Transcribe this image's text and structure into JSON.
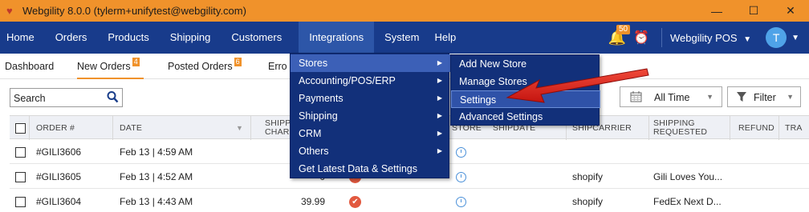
{
  "window": {
    "title": "Webgility 8.0.0 (tylerm+unifytest@webgility.com)",
    "minimize": "—",
    "maximize": "☐",
    "close": "✕"
  },
  "nav": {
    "items": [
      "Home",
      "Orders",
      "Products",
      "Shipping",
      "Customers",
      "Integrations",
      "System",
      "Help"
    ],
    "notifications_count": "50",
    "account": "Webgility POS",
    "avatar_initial": "T"
  },
  "tabs": [
    {
      "label": "Dashboard",
      "count": ""
    },
    {
      "label": "New Orders",
      "count": "4"
    },
    {
      "label": "Posted Orders",
      "count": "6"
    },
    {
      "label": "Erro",
      "count": ""
    }
  ],
  "toolbar": {
    "search_placeholder": "Search",
    "date_filter": "All Time",
    "filter_label": "Filter"
  },
  "table": {
    "columns": [
      "ORDER #",
      "DATE",
      "SHIPP\nCHAR",
      "STORE",
      "SHIPDATE",
      "SHIPCARRIER",
      "SHIPPING\nREQUESTED",
      "REFUND",
      "TRA"
    ],
    "rows": [
      {
        "order": "#GILI3606",
        "date": "Feb 13 | 4:59 AM",
        "shipping": "",
        "carrier": "",
        "requested": ""
      },
      {
        "order": "#GILI3605",
        "date": "Feb 13 | 4:52 AM",
        "shipping": "0",
        "carrier": "shopify",
        "requested": "Gili Loves You..."
      },
      {
        "order": "#GILI3604",
        "date": "Feb 13 | 4:43 AM",
        "shipping": "39.99",
        "carrier": "shopify",
        "requested": "FedEx Next D..."
      }
    ]
  },
  "integrations_menu": {
    "items": [
      "Stores",
      "Accounting/POS/ERP",
      "Payments",
      "Shipping",
      "CRM",
      "Others",
      "Get Latest Data & Settings"
    ]
  },
  "stores_submenu": {
    "items": [
      "Add New Store",
      "Manage Stores",
      "Settings",
      "Advanced Settings"
    ]
  },
  "colors": {
    "titlebar": "#f0922b",
    "navbar": "#183b8b",
    "menu": "#12307a",
    "accent": "#f0922b",
    "annotation_arrow": "#e0201b"
  }
}
